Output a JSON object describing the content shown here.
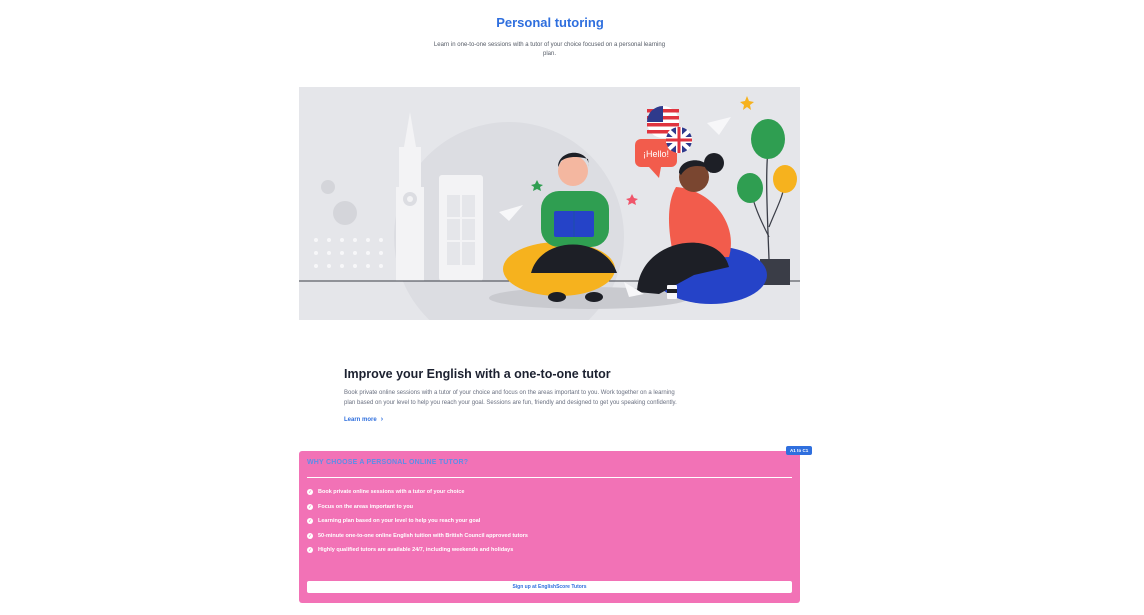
{
  "header": {
    "title": "Personal tutoring",
    "subtitle": "Learn in one-to-one sessions with a tutor of your choice focused on a personal learning plan."
  },
  "hero": {
    "speech_bubble": "¡Hello!",
    "flags": [
      "us-flag-icon",
      "uk-flag-icon"
    ]
  },
  "info": {
    "heading": "Improve your English with a one-to-one tutor",
    "body": "Book private online sessions with a tutor of your choice and focus on the areas important to you. Work together on a learning plan based on your level to help you reach your goal. Sessions are fun, friendly and designed to get you speaking confidently.",
    "learn_more": "Learn more",
    "learn_more_icon": "chevron-right-icon"
  },
  "panel": {
    "badge": "A1 to C1",
    "heading": "WHY CHOOSE A PERSONAL ONLINE TUTOR?",
    "benefits": [
      "Book private online sessions with a tutor of your choice",
      "Focus on the areas important to you",
      "Learning plan based on your level to help you reach your goal",
      "50-minute one-to-one online English tuition with British Council approved tutors",
      "Highly qualified tutors are available 24/7, including weekends and holidays"
    ],
    "cta": "Sign up at EnglishScore Tutors"
  },
  "colors": {
    "accent": "#2f6fde",
    "panel": "#f272b6",
    "hero_bg": "#e5e6ea"
  }
}
